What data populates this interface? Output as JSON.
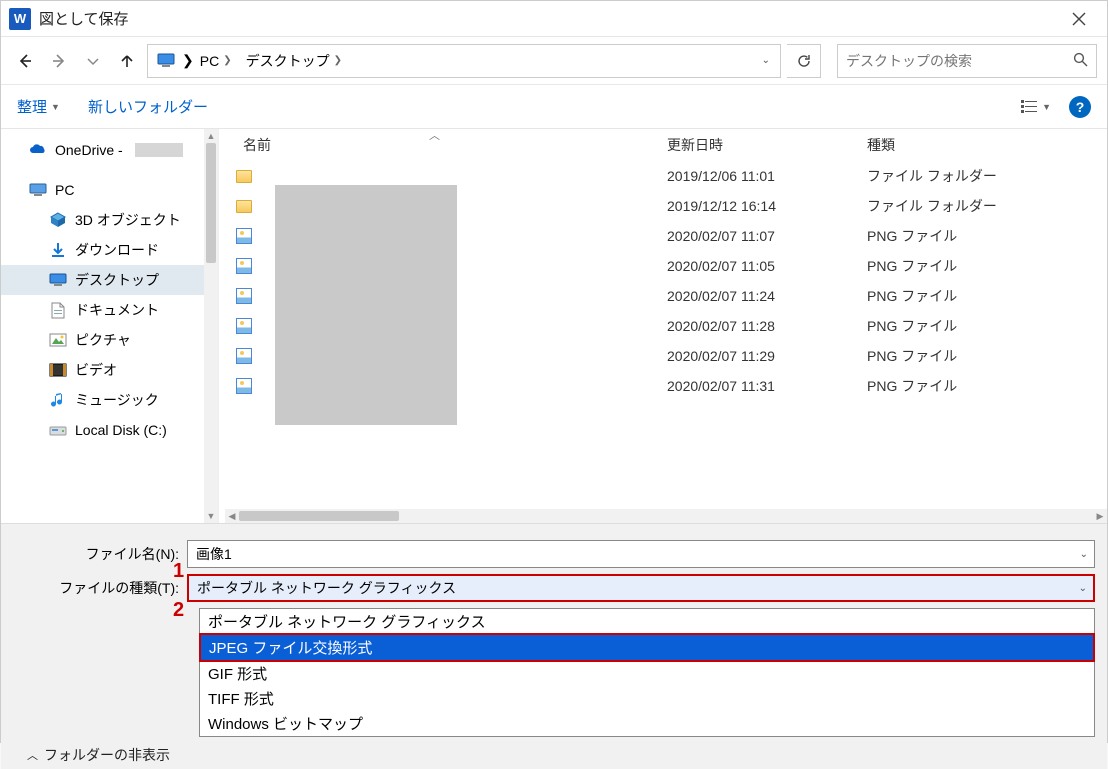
{
  "title": "図として保存",
  "breadcrumb": {
    "root": "PC",
    "folder": "デスクトップ"
  },
  "search_placeholder": "デスクトップの検索",
  "toolbar": {
    "organize": "整理",
    "new_folder": "新しいフォルダー"
  },
  "columns": {
    "name": "名前",
    "date": "更新日時",
    "type": "種類"
  },
  "sidebar": {
    "onedrive": "OneDrive -",
    "pc": "PC",
    "items": [
      {
        "label": "3D オブジェクト"
      },
      {
        "label": "ダウンロード"
      },
      {
        "label": "デスクトップ",
        "selected": true
      },
      {
        "label": "ドキュメント"
      },
      {
        "label": "ピクチャ"
      },
      {
        "label": "ビデオ"
      },
      {
        "label": "ミュージック"
      },
      {
        "label": "Local Disk (C:)"
      }
    ]
  },
  "files": [
    {
      "icon": "folder",
      "date": "2019/12/06 11:01",
      "type": "ファイル フォルダー"
    },
    {
      "icon": "folder",
      "date": "2019/12/12 16:14",
      "type": "ファイル フォルダー"
    },
    {
      "icon": "image",
      "date": "2020/02/07 11:07",
      "type": "PNG ファイル"
    },
    {
      "icon": "image",
      "date": "2020/02/07 11:05",
      "type": "PNG ファイル"
    },
    {
      "icon": "image",
      "date": "2020/02/07 11:24",
      "type": "PNG ファイル"
    },
    {
      "icon": "image",
      "date": "2020/02/07 11:28",
      "type": "PNG ファイル"
    },
    {
      "icon": "image",
      "date": "2020/02/07 11:29",
      "type": "PNG ファイル"
    },
    {
      "icon": "image",
      "date": "2020/02/07 11:31",
      "type": "PNG ファイル"
    }
  ],
  "filename_label": "ファイル名(N):",
  "filename_value": "画像1",
  "filetype_label": "ファイルの種類(T):",
  "filetype_value": "ポータブル ネットワーク グラフィックス",
  "filetype_options": [
    "ポータブル ネットワーク グラフィックス",
    "JPEG ファイル交換形式",
    "GIF 形式",
    "TIFF 形式",
    "Windows ビットマップ"
  ],
  "filetype_highlight_index": 1,
  "hide_folders": "フォルダーの非表示",
  "annotations": {
    "one": "1",
    "two": "2"
  }
}
